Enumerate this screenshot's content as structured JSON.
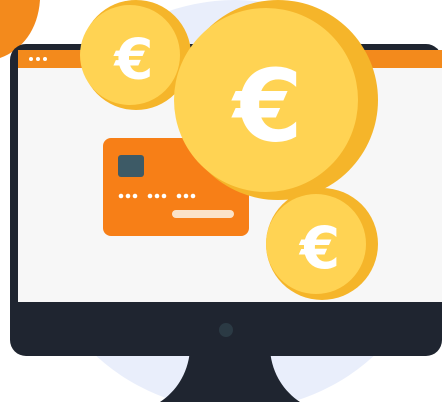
{
  "colors": {
    "background_circle": "#e9eefb",
    "orange_accent": "#f38a1c",
    "monitor_frame": "#1f2530",
    "screen": "#f7f7f7",
    "card": "#f77f17",
    "card_chip": "#3d5a66",
    "coin_light": "#ffd353",
    "coin_dark": "#f5b52a",
    "webcam_dot": "#2b3a44"
  },
  "icons": {
    "browser_dots": "three-dots-icon",
    "currency": "euro-icon",
    "card": "credit-card-icon"
  },
  "coins": {
    "small": {
      "symbol": "€"
    },
    "large": {
      "symbol": "€"
    },
    "right": {
      "symbol": "€"
    }
  },
  "card": {
    "masked_number": "••• ••• •••"
  }
}
